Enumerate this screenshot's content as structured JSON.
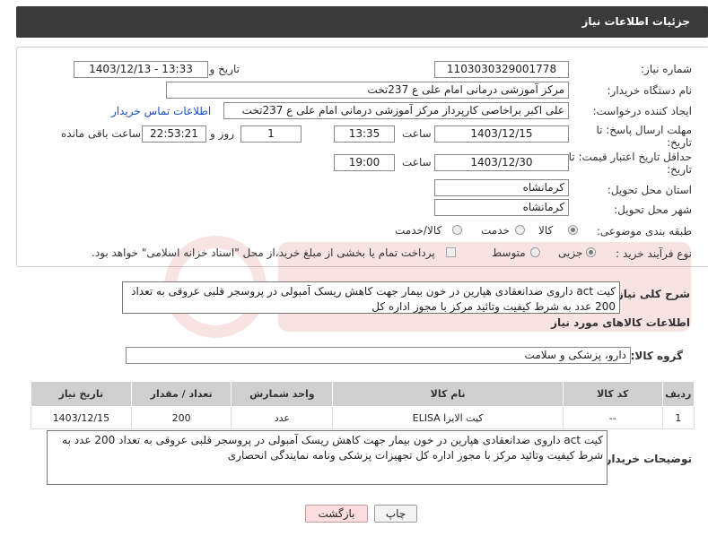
{
  "header": {
    "title": "جزئیات اطلاعات نیاز"
  },
  "form": {
    "need_number": {
      "label": "شماره نیاز:",
      "value": "1103030329001778"
    },
    "announce_datetime": {
      "label": "تاریخ و ساعت اعلان عمومی:",
      "value": "1403/12/13 - 13:33"
    },
    "buyer_org": {
      "label": "نام دستگاه خریدار:",
      "value": "مرکز آموزشی درمانی امام علی ع 237تخت"
    },
    "requester": {
      "label": "ایجاد کننده درخواست:",
      "value": "علی اکبر براخاصی کارپرداز  مرکز آموزشی درمانی امام علی ع 237تخت",
      "link": "اطلاعات تماس خریدار"
    },
    "reply_deadline": {
      "label_line1": "مهلت ارسال پاسخ: تا",
      "label_line2": "تاریخ:",
      "date": "1403/12/15",
      "time_label": "ساعت",
      "time": "13:35",
      "days": "1",
      "days_label": "روز و",
      "remaining": "22:53:21",
      "remaining_label": "ساعت باقی مانده"
    },
    "price_validity": {
      "label_line1": "حداقل تاریخ اعتبار قیمت: تا",
      "label_line2": "تاریخ:",
      "date": "1403/12/30",
      "time_label": "ساعت",
      "time": "19:00"
    },
    "province": {
      "label": "استان محل تحویل:",
      "value": "کرمانشاه"
    },
    "city": {
      "label": "شهر محل تحویل:",
      "value": "کرمانشاه"
    },
    "category": {
      "label": "طبقه بندی موضوعی:",
      "options": [
        "کالا",
        "خدمت",
        "کالا/خدمت"
      ],
      "selected": "کالا"
    },
    "process_type": {
      "label": "نوع فرآیند خرید :",
      "options": [
        "جزیی",
        "متوسط"
      ],
      "selected": "جزیی",
      "note": "پرداخت تمام یا بخشی از مبلغ خرید،از محل \"اسناد خزانه اسلامی\" خواهد بود."
    }
  },
  "description": {
    "label": "شرح کلی نیاز:",
    "value": "کیت act داروی ضدانعقادی هپارین در خون بیمار جهت کاهش  ریسک آمبولی در پروسجر قلبی عروقی  به تعداد 200 عدد به شرط کیفیت وتائید مرکز با مجوز اداره کل"
  },
  "goods_info": {
    "title": "اطلاعات کالاهای مورد نیاز",
    "group_label": "گروه کالا:",
    "group_value": "دارو، پزشکی و سلامت"
  },
  "table": {
    "columns": [
      "ردیف",
      "کد کالا",
      "نام کالا",
      "واحد شمارش",
      "تعداد / مقدار",
      "تاریخ نیاز"
    ],
    "rows": [
      [
        "1",
        "--",
        "کیت الایزا ELISA",
        "عدد",
        "200",
        "1403/12/15"
      ]
    ]
  },
  "buyer_notes": {
    "label": "توضیحات خریدار:",
    "value": "کیت act داروی ضدانعقادی هپارین در خون بیمار جهت کاهش  ریسک آمبولی در پروسجر قلبی عروقی  به تعداد 200 عدد به شرط کیفیت وتائید مرکز با مجوز اداره کل تجهیزات پزشکی ونامه نمایندگی انحصاری"
  },
  "buttons": {
    "print": "چاپ",
    "back": "بازگشت"
  },
  "colors": {
    "header_bg": "#3a3a3a",
    "link": "#1a4fc4",
    "back_button_bg": "#fcdede",
    "table_header_bg": "#cfcfcf"
  }
}
